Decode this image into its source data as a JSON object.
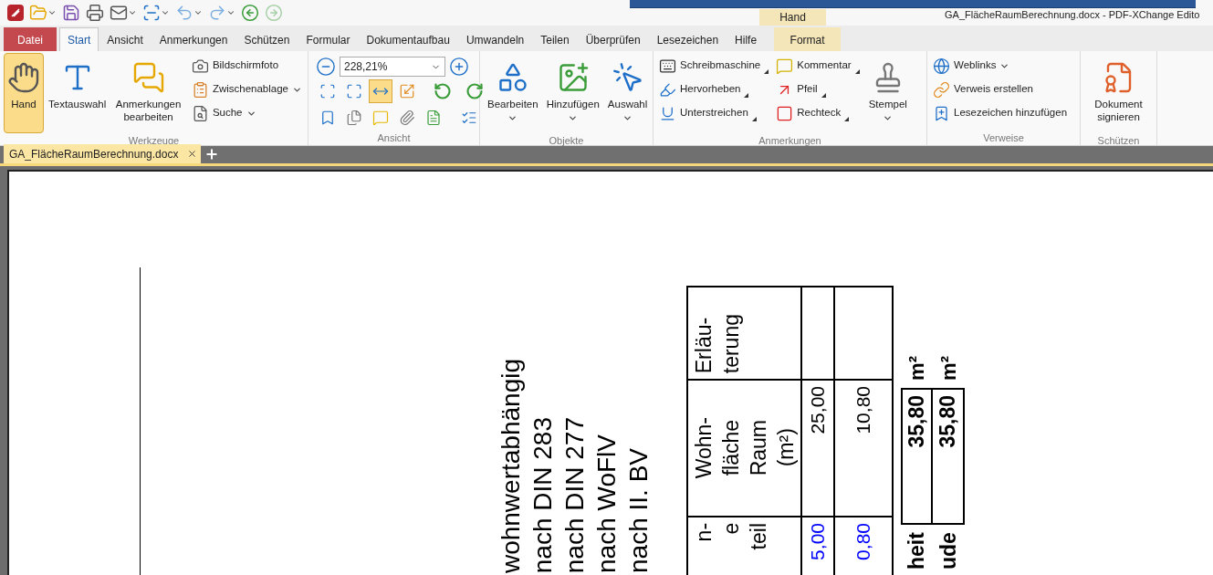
{
  "title_bar": {
    "title": "GA_FlächeRaumBerechnung.docx - PDF-XChange Edito",
    "contextual_group": "Hand"
  },
  "tabs": [
    {
      "label": "Datei",
      "kind": "file",
      "selected": false
    },
    {
      "label": "Start",
      "kind": "tab",
      "selected": true
    },
    {
      "label": "Ansicht",
      "kind": "tab",
      "selected": false
    },
    {
      "label": "Anmerkungen",
      "kind": "tab",
      "selected": false
    },
    {
      "label": "Schützen",
      "kind": "tab",
      "selected": false
    },
    {
      "label": "Formular",
      "kind": "tab",
      "selected": false
    },
    {
      "label": "Dokumentaufbau",
      "kind": "tab",
      "selected": false
    },
    {
      "label": "Umwandeln",
      "kind": "tab",
      "selected": false
    },
    {
      "label": "Teilen",
      "kind": "tab",
      "selected": false
    },
    {
      "label": "Überprüfen",
      "kind": "tab",
      "selected": false
    },
    {
      "label": "Lesezeichen",
      "kind": "tab",
      "selected": false
    },
    {
      "label": "Hilfe",
      "kind": "tab",
      "selected": false
    },
    {
      "label": "Format",
      "kind": "contextual",
      "selected": false
    }
  ],
  "ribbon": {
    "groups": [
      {
        "label": "Werkzeuge",
        "sections": [
          {
            "kind": "large",
            "items": [
              {
                "label": "Hand",
                "selected": true,
                "dropdown": false
              },
              {
                "label": "Textauswahl",
                "selected": false,
                "dropdown": false
              },
              {
                "label": "Anmerkungen bearbeiten",
                "selected": false,
                "dropdown": false
              }
            ]
          },
          {
            "kind": "small",
            "items": [
              {
                "label": "Bildschirmfoto",
                "dropdown": false
              },
              {
                "label": "Zwischenablage",
                "dropdown": true
              },
              {
                "label": "Suche",
                "dropdown": true
              }
            ]
          }
        ]
      },
      {
        "label": "Ansicht",
        "sections": [
          {
            "kind": "view",
            "zoom": "228,21%",
            "buttons": [
              {
                "selected": false,
                "highlighted": false
              },
              {
                "selected": false,
                "highlighted": false
              },
              {
                "selected": true,
                "highlighted": false
              },
              {
                "selected": false,
                "highlighted": false
              },
              {
                "selected": false,
                "highlighted": false
              },
              {
                "selected": false,
                "highlighted": true
              }
            ]
          }
        ]
      },
      {
        "label": "Objekte",
        "sections": [
          {
            "kind": "large",
            "items": [
              {
                "label": "Bearbeiten",
                "selected": false,
                "dropdown": true
              },
              {
                "label": "Hinzufügen",
                "selected": false,
                "dropdown": true
              },
              {
                "label": "Auswahl",
                "selected": false,
                "dropdown": true
              }
            ]
          }
        ]
      },
      {
        "label": "Anmerkungen",
        "sections": [
          {
            "kind": "small",
            "items": [
              {
                "label": "Schreibmaschine",
                "flyout": true
              },
              {
                "label": "Hervorheben",
                "flyout": true
              },
              {
                "label": "Unterstreichen",
                "flyout": true
              }
            ]
          },
          {
            "kind": "small",
            "items": [
              {
                "label": "Kommentar",
                "flyout": true
              },
              {
                "label": "Pfeil",
                "flyout": true
              },
              {
                "label": "Rechteck",
                "flyout": true
              }
            ]
          },
          {
            "kind": "large",
            "items": [
              {
                "label": "Stempel",
                "selected": false,
                "dropdown": true
              }
            ]
          }
        ]
      },
      {
        "label": "Verweise",
        "sections": [
          {
            "kind": "small",
            "items": [
              {
                "label": "Weblinks",
                "dropdown": true
              },
              {
                "label": "Verweis erstellen",
                "dropdown": false
              },
              {
                "label": "Lesezeichen hinzufügen",
                "dropdown": false
              }
            ]
          }
        ]
      },
      {
        "label": "Schützen",
        "sections": [
          {
            "kind": "large",
            "items": [
              {
                "label": "Dokument signieren",
                "selected": false,
                "dropdown": false
              }
            ]
          }
        ]
      }
    ]
  },
  "document_tabs": [
    {
      "label": "GA_FlächeRaumBerechnung.docx",
      "selected": true
    }
  ],
  "document": {
    "lines": [
      "wohnwertabhängig",
      "nach DIN 283",
      "nach DIN 277",
      "nach WoFlV",
      "nach II. BV"
    ],
    "table": {
      "rows": [
        {
          "heading": [
            "Erläu-",
            "terung"
          ]
        },
        {
          "heading": [
            "Wohn-",
            "fläche",
            "Raum",
            "(m²)"
          ],
          "values": [
            {
              "text": "25,00",
              "color": "#000000"
            },
            {
              "text": "10,80",
              "color": "#000000"
            }
          ]
        },
        {
          "heading": [
            "n-",
            "e",
            "teil"
          ],
          "values": [
            {
              "text": "5,00",
              "color": "#0000ff"
            },
            {
              "text": "0,80",
              "color": "#0000ff"
            }
          ]
        }
      ]
    },
    "totals": [
      {
        "label": "heit",
        "value": "35,80",
        "unit": "m²"
      },
      {
        "label": "ude",
        "value": "35,80",
        "unit": "m²"
      }
    ]
  }
}
